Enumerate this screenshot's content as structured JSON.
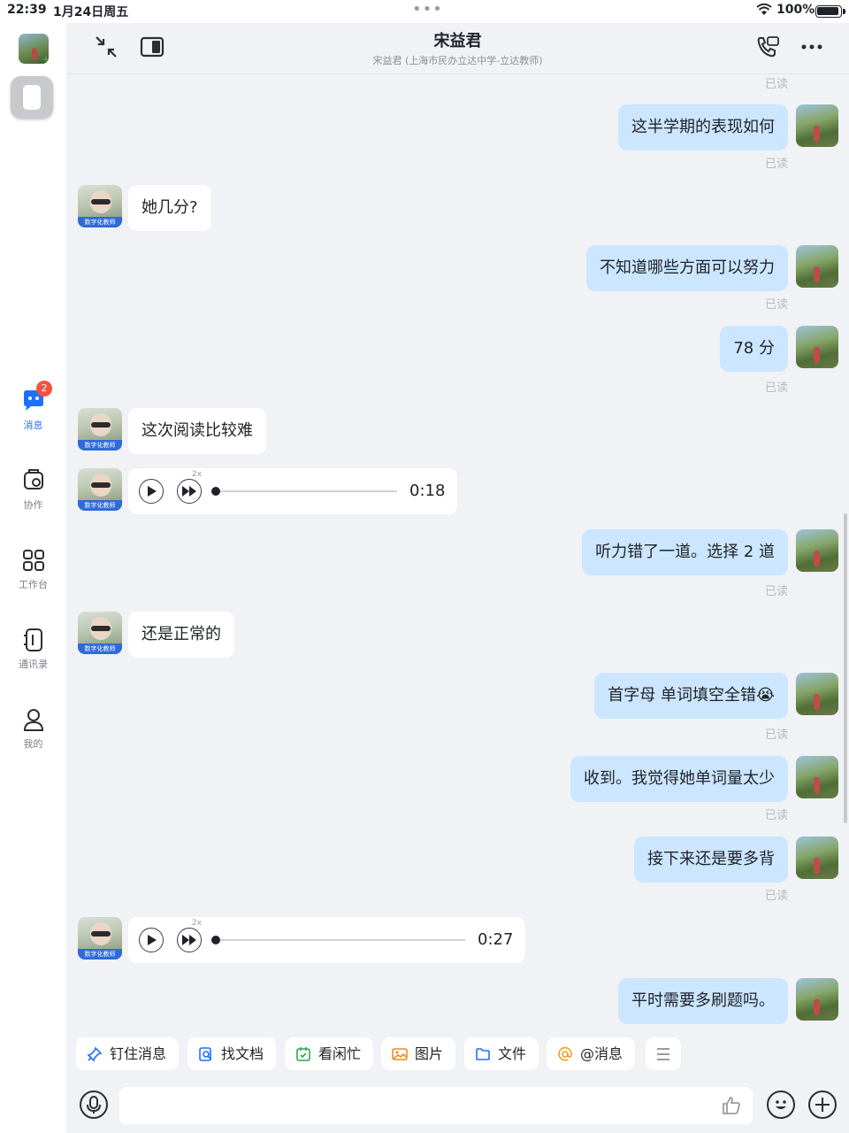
{
  "status_bar": {
    "time": "22:39",
    "date": "1月24日周五",
    "battery": "100%"
  },
  "sidebar": {
    "items": [
      {
        "label": "消息",
        "badge": "2",
        "icon": "chat-bubble-icon",
        "active": true
      },
      {
        "label": "协作",
        "icon": "collaboration-icon"
      },
      {
        "label": "工作台",
        "icon": "grid-icon"
      },
      {
        "label": "通讯录",
        "icon": "contacts-icon"
      },
      {
        "label": "我的",
        "icon": "person-icon"
      }
    ]
  },
  "header": {
    "title": "宋益君",
    "subtitle": "宋益君 (上海市民办立达中学-立达教师)"
  },
  "chat": {
    "read_label": "已读",
    "avatar_tag": "数字化教师",
    "messages": [
      {
        "from": "me",
        "text": "这半学期的表现如何"
      },
      {
        "from": "them",
        "text": "她几分?"
      },
      {
        "from": "me",
        "text": "不知道哪些方面可以努力"
      },
      {
        "from": "me",
        "text": "78 分"
      },
      {
        "from": "them",
        "text": "这次阅读比较难"
      },
      {
        "from": "them",
        "type": "voice",
        "duration": "0:18",
        "speed": "2x"
      },
      {
        "from": "me",
        "text": "听力错了一道。选择 2 道"
      },
      {
        "from": "them",
        "text": "还是正常的"
      },
      {
        "from": "me",
        "text": "首字母 单词填空全错😭"
      },
      {
        "from": "me",
        "text": "收到。我觉得她单词量太少"
      },
      {
        "from": "me",
        "text": "接下来还是要多背"
      },
      {
        "from": "them",
        "type": "voice",
        "duration": "0:27",
        "speed": "2x"
      },
      {
        "from": "me",
        "text": "平时需要多刷题吗。"
      }
    ]
  },
  "quick_actions": [
    "钉住消息",
    "找文档",
    "看闲忙",
    "图片",
    "文件",
    "@消息"
  ],
  "input": {
    "placeholder": ""
  },
  "colors": {
    "accent": "#1f6fff",
    "my_bubble": "#cce6ff",
    "badge": "#f5533d"
  }
}
